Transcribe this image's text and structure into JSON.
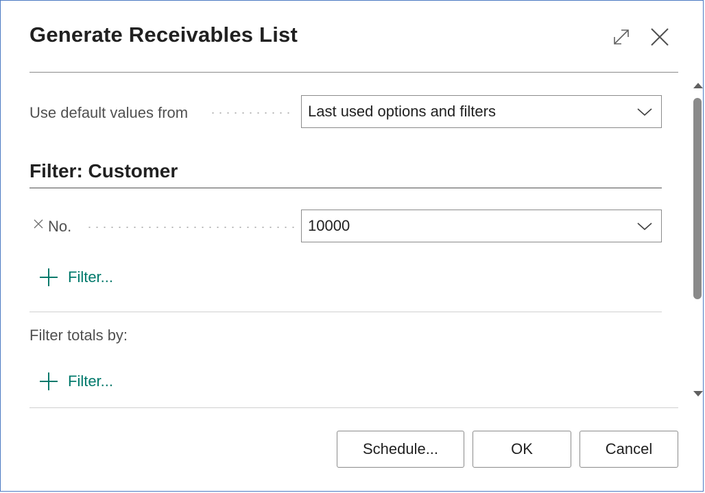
{
  "dialog": {
    "title": "Generate Receivables List",
    "expand_icon": "expand-icon",
    "close_icon": "close-icon"
  },
  "options": {
    "default_values_label": "Use default values from",
    "default_values_value": "Last used options and filters"
  },
  "filter_customer": {
    "section_title": "Filter: Customer",
    "no_label": "No.",
    "no_value": "10000",
    "add_filter_label": "Filter..."
  },
  "filter_totals": {
    "label": "Filter totals by:",
    "add_filter_label": "Filter..."
  },
  "buttons": {
    "schedule": "Schedule...",
    "ok": "OK",
    "cancel": "Cancel"
  },
  "colors": {
    "accent": "#00796b",
    "border": "#4a78c2"
  }
}
